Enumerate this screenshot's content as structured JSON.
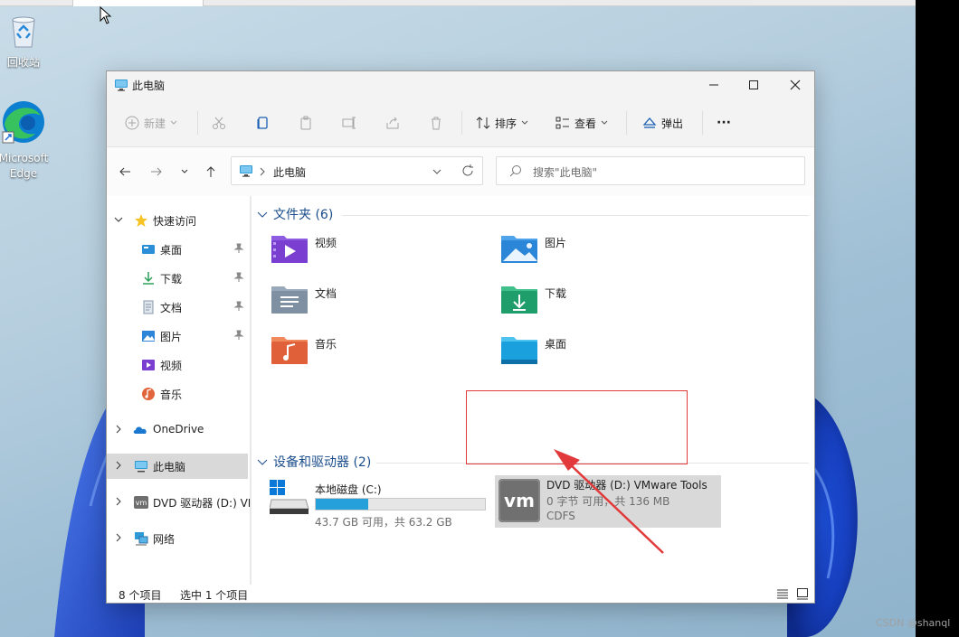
{
  "desktop": {
    "icons": [
      {
        "label": "回收站",
        "icon": "recycle-bin-icon"
      },
      {
        "label": "Microsoft Edge",
        "icon": "edge-icon"
      }
    ]
  },
  "window": {
    "title": "此电脑",
    "controls": {
      "minimize": "minimize-icon",
      "maximize": "maximize-icon",
      "close": "close-icon"
    }
  },
  "toolbar": {
    "new_label": "新建",
    "sort_label": "排序",
    "view_label": "查看",
    "eject_label": "弹出",
    "more_label": "···"
  },
  "address": {
    "path": "此电脑",
    "search_placeholder": "搜索\"此电脑\""
  },
  "sidebar": {
    "quick_access": "快速访问",
    "items": [
      {
        "label": "桌面",
        "icon": "desktop-icon",
        "pinned": true
      },
      {
        "label": "下载",
        "icon": "download-icon",
        "pinned": true
      },
      {
        "label": "文档",
        "icon": "document-icon",
        "pinned": true
      },
      {
        "label": "图片",
        "icon": "pictures-icon",
        "pinned": true
      },
      {
        "label": "视频",
        "icon": "video-icon",
        "pinned": false
      },
      {
        "label": "音乐",
        "icon": "music-icon",
        "pinned": false
      }
    ],
    "onedrive": "OneDrive",
    "this_pc": "此电脑",
    "dvd": "DVD 驱动器 (D:) VI",
    "network": "网络"
  },
  "content": {
    "folders_header": "文件夹 (6)",
    "folders": [
      {
        "label": "视频",
        "icon": "video-folder-icon"
      },
      {
        "label": "图片",
        "icon": "pictures-folder-icon"
      },
      {
        "label": "文档",
        "icon": "documents-folder-icon"
      },
      {
        "label": "下载",
        "icon": "downloads-folder-icon"
      },
      {
        "label": "音乐",
        "icon": "music-folder-icon"
      },
      {
        "label": "桌面",
        "icon": "desktop-folder-icon"
      }
    ],
    "drives_header": "设备和驱动器 (2)",
    "drives": [
      {
        "label": "本地磁盘 (C:)",
        "sub": "43.7 GB 可用，共 63.2 GB",
        "used_fraction": 0.31,
        "icon": "local-disk-icon"
      },
      {
        "label": "DVD 驱动器 (D:) VMware Tools",
        "sub": "0 字节 可用，共 136 MB",
        "fs": "CDFS",
        "icon": "vmware-dvd-icon"
      }
    ]
  },
  "status": {
    "count": "8 个项目",
    "selected": "选中 1 个项目"
  },
  "watermark": "CSDN @shanql",
  "colors": {
    "accent": "#0078d4",
    "disk_fill": "#26a0da",
    "highlight": "#e23a3a",
    "selection": "#d9d9d9"
  }
}
